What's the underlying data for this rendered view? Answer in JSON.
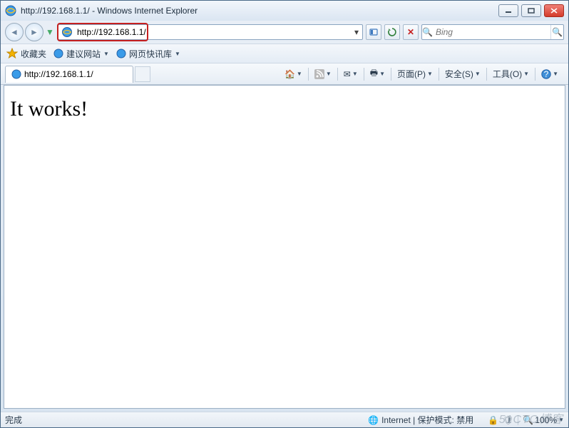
{
  "window": {
    "title": "http://192.168.1.1/ - Windows Internet Explorer"
  },
  "nav": {
    "url": "http://192.168.1.1/",
    "search_placeholder": "Bing"
  },
  "favorites": {
    "label": "收藏夹",
    "items": [
      {
        "label": "建议网站"
      },
      {
        "label": "网页快讯库"
      }
    ]
  },
  "tab": {
    "title": "http://192.168.1.1/"
  },
  "commandbar": {
    "page": "页面(P)",
    "safety": "安全(S)",
    "tools": "工具(O)"
  },
  "page": {
    "heading": "It works!"
  },
  "status": {
    "left": "完成",
    "zone": "Internet | 保护模式: 禁用",
    "zoom": "100%"
  },
  "watermark": "51CTO博客"
}
